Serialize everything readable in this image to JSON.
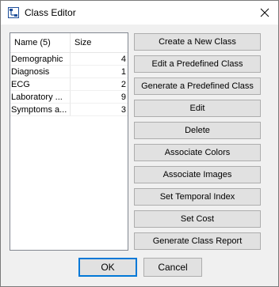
{
  "window": {
    "title": "Class Editor"
  },
  "table": {
    "columns": [
      "Name (5)",
      "Size"
    ],
    "rows": [
      {
        "name": "Demographic",
        "size": "4"
      },
      {
        "name": "Diagnosis",
        "size": "1"
      },
      {
        "name": "ECG",
        "size": "2"
      },
      {
        "name": "Laboratory ...",
        "size": "9"
      },
      {
        "name": "Symptoms a...",
        "size": "3"
      }
    ]
  },
  "buttons": {
    "create_new": "Create a New Class",
    "edit_predefined": "Edit a Predefined Class",
    "generate_predefined": "Generate a Predefined Class",
    "edit": "Edit",
    "delete": "Delete",
    "associate_colors": "Associate Colors",
    "associate_images": "Associate Images",
    "set_temporal_index": "Set Temporal Index",
    "set_cost": "Set Cost",
    "generate_report": "Generate Class Report",
    "ok": "OK",
    "cancel": "Cancel"
  },
  "icons": {
    "app": "class-editor-icon",
    "close": "close-icon"
  }
}
